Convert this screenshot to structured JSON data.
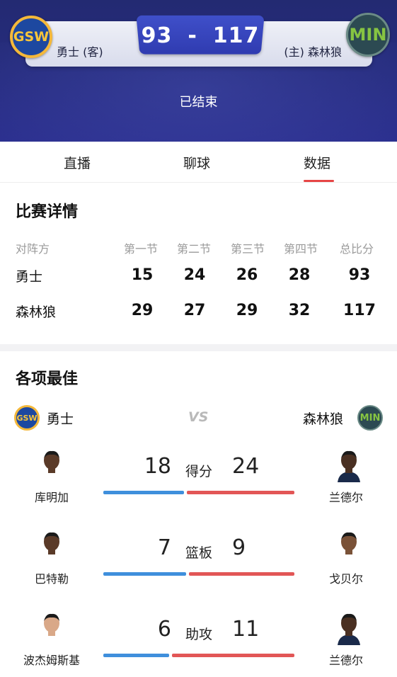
{
  "header": {
    "away_team": "勇士 (客)",
    "home_team": "(主) 森林狼",
    "away_score": "93",
    "separator": "-",
    "home_score": "117",
    "status": "已结束",
    "away_logo_text": "GSW",
    "home_logo_text": "MIN"
  },
  "tabs": [
    "直播",
    "聊球",
    "数据"
  ],
  "active_tab": "数据",
  "match_details": {
    "title": "比赛详情",
    "columns": [
      "对阵方",
      "第一节",
      "第二节",
      "第三节",
      "第四节",
      "总比分"
    ],
    "rows": [
      {
        "team": "勇士",
        "scores": [
          "15",
          "24",
          "26",
          "28",
          "93"
        ]
      },
      {
        "team": "森林狼",
        "scores": [
          "29",
          "27",
          "29",
          "32",
          "117"
        ]
      }
    ]
  },
  "best": {
    "title": "各项最佳",
    "left_team": "勇士",
    "right_team": "森林狼",
    "vs": "VS",
    "left_logo_text": "GSW",
    "right_logo_text": "MIN",
    "stats": [
      {
        "label": "得分",
        "left_player": "库明加",
        "left_value": "18",
        "right_player": "兰德尔",
        "right_value": "24",
        "left_share": 0.43
      },
      {
        "label": "篮板",
        "left_player": "巴特勒",
        "left_value": "7",
        "right_player": "戈贝尔",
        "right_value": "9",
        "left_share": 0.44
      },
      {
        "label": "助攻",
        "left_player": "波杰姆斯基",
        "left_value": "6",
        "right_player": "兰德尔",
        "right_value": "11",
        "left_share": 0.35
      }
    ]
  },
  "colors": {
    "header_bg": "#262c7d",
    "score_box": "#3342b8",
    "accent_red": "#e64545",
    "bar_blue": "#3f8fdc",
    "bar_red": "#e25656"
  }
}
